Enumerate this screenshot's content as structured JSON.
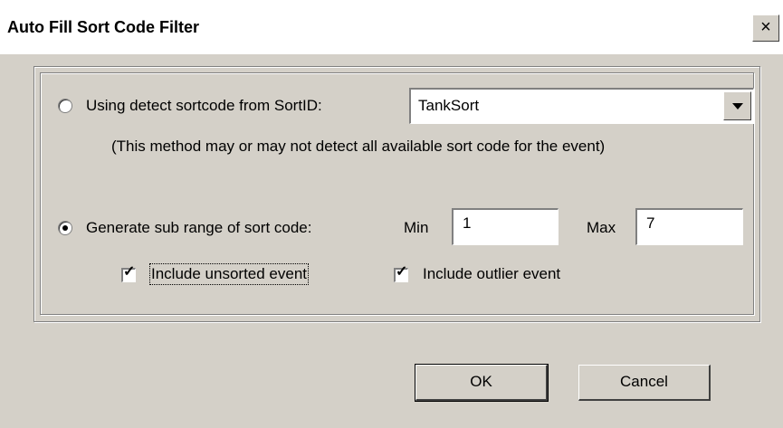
{
  "window": {
    "title": "Auto Fill Sort Code Filter",
    "close_glyph": "×"
  },
  "option_sortid": {
    "label": "Using detect sortcode from SortID:",
    "selected": false,
    "combo_value": "TankSort",
    "note": "(This method may or may not detect all available sort code for the event)"
  },
  "option_subrange": {
    "label": "Generate sub range of sort code:",
    "selected": true,
    "min_label": "Min",
    "min_value": "1",
    "max_label": "Max",
    "max_value": "7"
  },
  "checkboxes": {
    "unsorted_label": "Include unsorted event",
    "unsorted_checked": true,
    "outlier_label": "Include outlier event",
    "outlier_checked": true,
    "check_glyph": "✓"
  },
  "buttons": {
    "ok_label": "OK",
    "cancel_label": "Cancel"
  },
  "icons": {
    "close": "close-icon",
    "dropdown": "chevron-down-icon",
    "check": "check-icon"
  }
}
